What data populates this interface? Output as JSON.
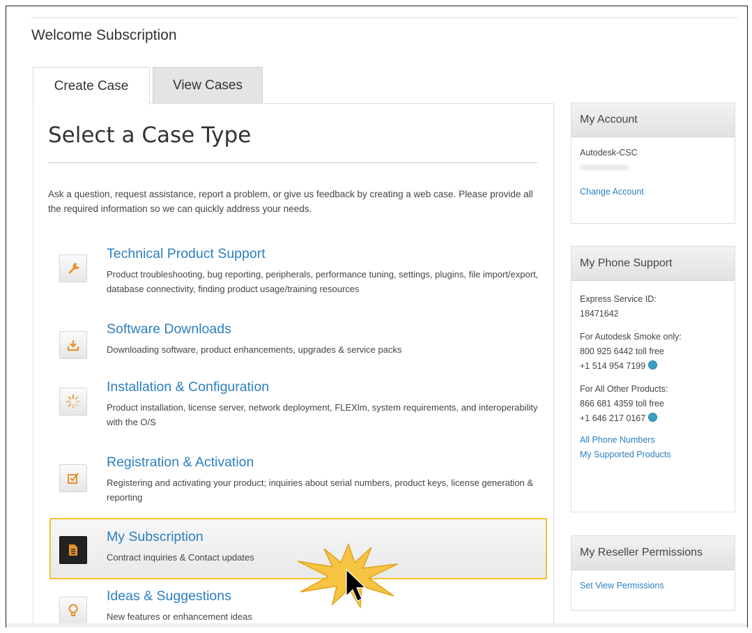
{
  "page": {
    "welcome": "Welcome Subscription"
  },
  "tabs": [
    {
      "label": "Create Case",
      "active": true
    },
    {
      "label": "View Cases",
      "active": false
    }
  ],
  "main": {
    "title": "Select a Case Type",
    "intro": "Ask a question, request assistance, report a problem, or give us feedback by creating a web case. Please provide all the required information so we can quickly address your needs.",
    "cases": [
      {
        "title": "Technical Product Support",
        "desc": "Product troubleshooting, bug reporting, peripherals, performance tuning, settings, plugins, file import/export, database connectivity, finding product usage/training resources",
        "icon": "wrench-icon"
      },
      {
        "title": "Software Downloads",
        "desc": "Downloading software, product enhancements, upgrades & service packs",
        "icon": "download-icon"
      },
      {
        "title": "Installation & Configuration",
        "desc": "Product installation, license server, network deployment, FLEXlm, system requirements, and interoperability with the O/S",
        "icon": "spinner-icon"
      },
      {
        "title": "Registration & Activation",
        "desc": "Registering and activating your product; inquiries about serial numbers, product keys, license generation & reporting",
        "icon": "checkbox-icon"
      },
      {
        "title": "My Subscription",
        "desc": "Contract inquiries & Contact updates",
        "icon": "document-icon"
      },
      {
        "title": "Ideas & Suggestions",
        "desc": "New features or enhancement ideas",
        "icon": "lightbulb-icon"
      }
    ]
  },
  "sidebar": {
    "account": {
      "heading": "My Account",
      "name": "Autodesk-CSC",
      "change": "Change Account"
    },
    "phone": {
      "heading": "My Phone Support",
      "express_label": "Express Service ID:",
      "express_id": "18471642",
      "smoke_label": "For Autodesk Smoke only:",
      "smoke_tollfree": "800 925 6442 toll free",
      "smoke_intl": "+1 514 954 7199",
      "other_label": "For All Other Products:",
      "other_tollfree": "866 681 4359 toll free",
      "other_intl": "+1 646 217 0167",
      "all_numbers": "All Phone Numbers",
      "supported": "My Supported Products"
    },
    "reseller": {
      "heading": "My Reseller Permissions",
      "link": "Set View Permissions"
    }
  },
  "colors": {
    "link": "#2c7fc0",
    "icon_orange": "#e8912c",
    "highlight": "#f1c232"
  }
}
